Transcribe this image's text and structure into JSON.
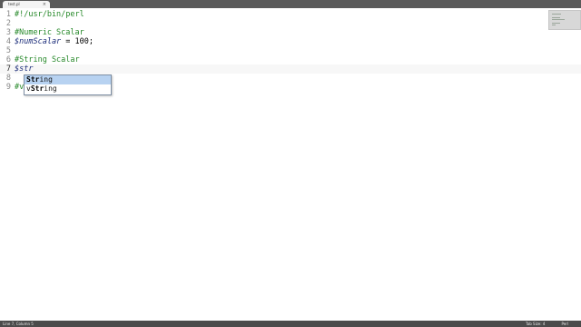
{
  "tab": {
    "name": "test.pl",
    "close": "×"
  },
  "gutter": [
    "1",
    "2",
    "3",
    "4",
    "5",
    "6",
    "7",
    "8",
    "9"
  ],
  "code": {
    "l1": "#!/usr/bin/perl",
    "l3": "#Numeric Scalar",
    "l4_var": "$numScalar",
    "l4_rest": " = 100;",
    "l6": "#String Scalar",
    "l7_var": "$str",
    "l9_prefix": "#v"
  },
  "autocomplete": {
    "items": [
      {
        "bold": "Str",
        "rest": "ing",
        "pre": ""
      },
      {
        "pre": "v",
        "bold": "Str",
        "rest": "ing"
      }
    ]
  },
  "status": {
    "position": "Line 7, Column 5",
    "tab_size": "Tab Size: 4",
    "syntax": "Perl"
  }
}
